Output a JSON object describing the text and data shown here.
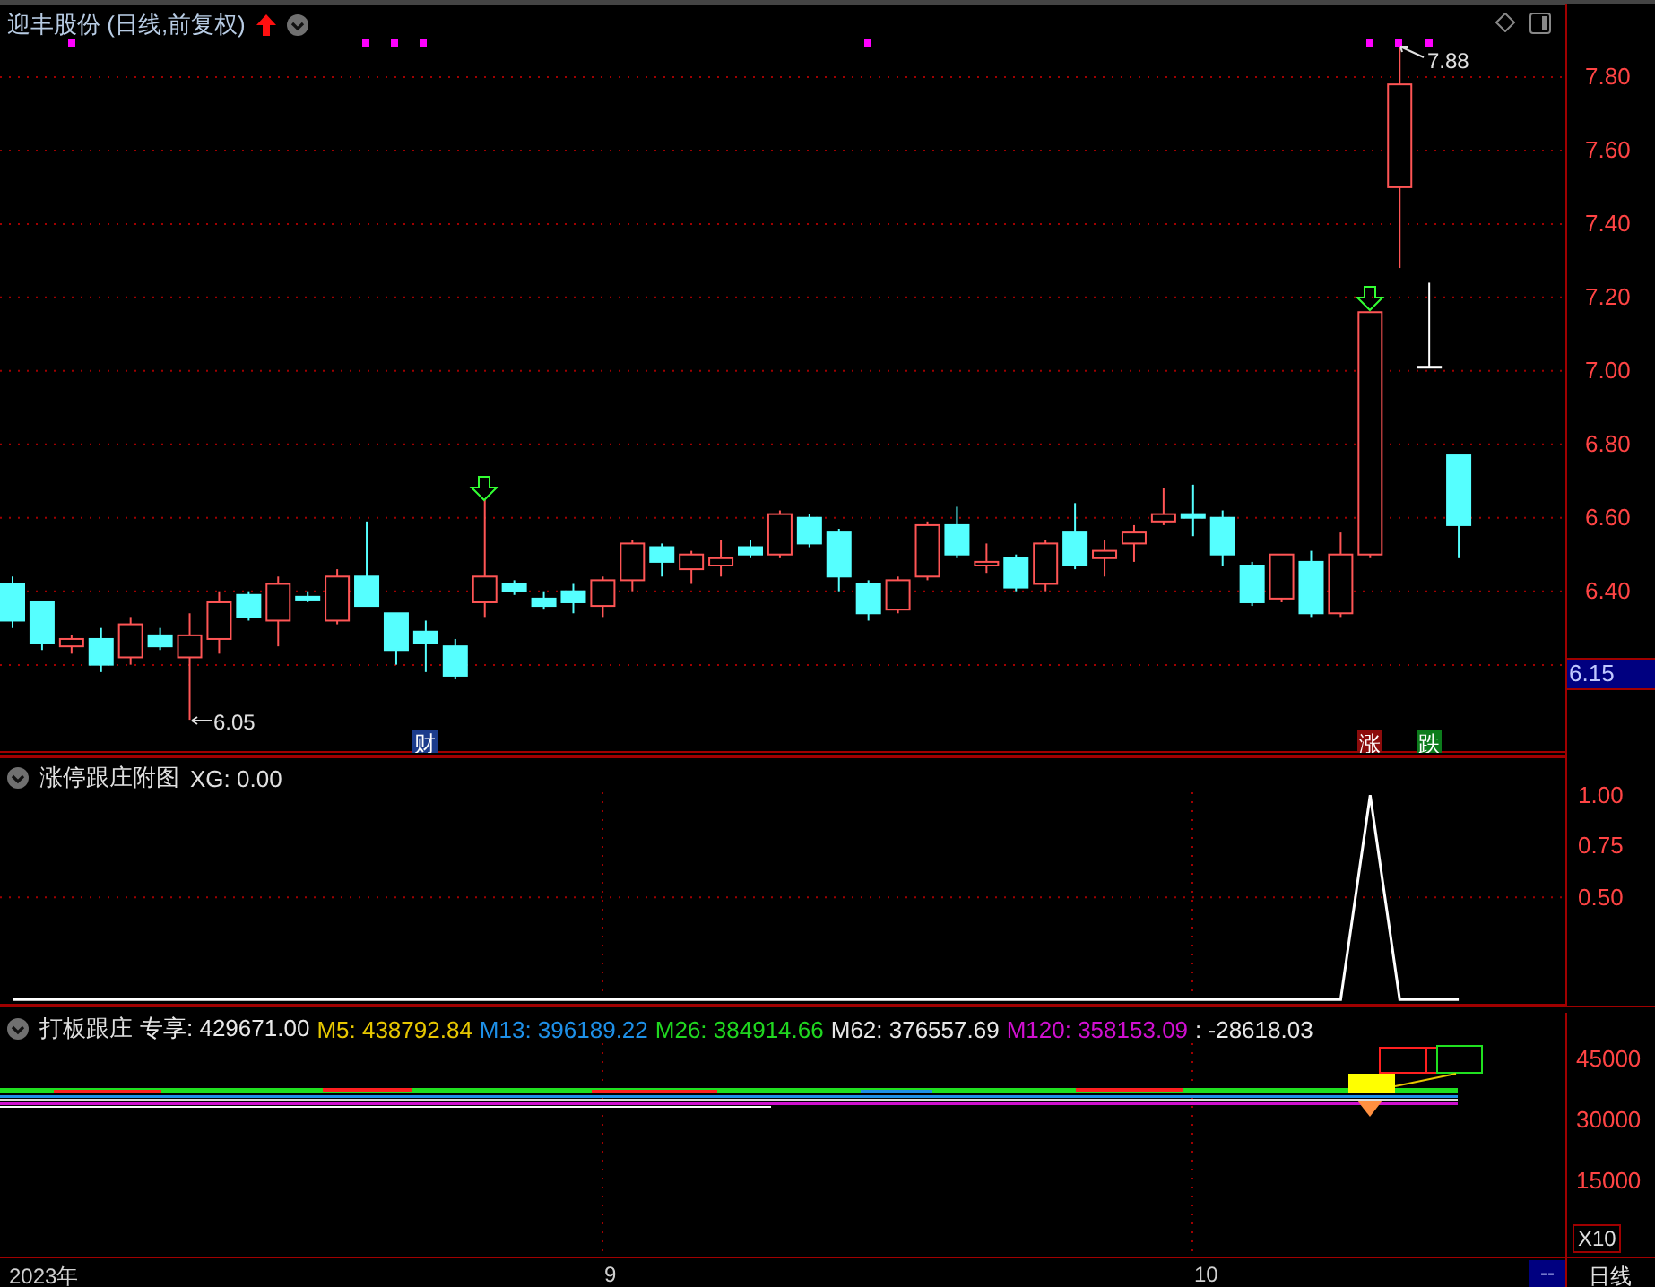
{
  "price_panel": {
    "title": "迎丰股份 (日线,前复权)",
    "current_price": "6.15",
    "low_label": "6.05",
    "high_label": "7.88",
    "markers": [
      {
        "label": "财",
        "color": "#1c3c8c"
      },
      {
        "label": "涨",
        "color": "#8c0c0c"
      },
      {
        "label": "跌",
        "color": "#0c7c1c"
      }
    ],
    "chart_data": {
      "type": "candlestick",
      "ylim": [
        5.96,
        8.0
      ],
      "grid": true,
      "yticks": [
        {
          "value": 7.8,
          "label": "7.80"
        },
        {
          "value": 7.6,
          "label": "7.60"
        },
        {
          "value": 7.4,
          "label": "7.40"
        },
        {
          "value": 7.2,
          "label": "7.20"
        },
        {
          "value": 7.0,
          "label": "7.00"
        },
        {
          "value": 6.8,
          "label": "6.80"
        },
        {
          "value": 6.6,
          "label": "6.60"
        },
        {
          "value": 6.4,
          "label": "6.40"
        }
      ],
      "ohlc": [
        [
          6.42,
          6.44,
          6.3,
          6.32
        ],
        [
          6.37,
          6.37,
          6.24,
          6.26
        ],
        [
          6.25,
          6.28,
          6.23,
          6.27
        ],
        [
          6.27,
          6.3,
          6.18,
          6.2
        ],
        [
          6.22,
          6.33,
          6.2,
          6.31
        ],
        [
          6.28,
          6.3,
          6.24,
          6.25
        ],
        [
          6.22,
          6.34,
          6.05,
          6.28
        ],
        [
          6.27,
          6.4,
          6.23,
          6.37
        ],
        [
          6.39,
          6.4,
          6.32,
          6.33
        ],
        [
          6.32,
          6.44,
          6.25,
          6.42
        ],
        [
          6.385,
          6.4,
          6.37,
          6.375
        ],
        [
          6.32,
          6.46,
          6.31,
          6.44
        ],
        [
          6.44,
          6.59,
          6.36,
          6.36
        ],
        [
          6.34,
          6.34,
          6.2,
          6.24
        ],
        [
          6.29,
          6.32,
          6.18,
          6.26
        ],
        [
          6.25,
          6.27,
          6.16,
          6.17
        ],
        [
          6.37,
          6.65,
          6.33,
          6.44
        ],
        [
          6.42,
          6.43,
          6.39,
          6.4
        ],
        [
          6.38,
          6.4,
          6.35,
          6.36
        ],
        [
          6.4,
          6.42,
          6.34,
          6.37
        ],
        [
          6.36,
          6.44,
          6.33,
          6.43
        ],
        [
          6.43,
          6.54,
          6.4,
          6.53
        ],
        [
          6.52,
          6.53,
          6.44,
          6.48
        ],
        [
          6.46,
          6.51,
          6.42,
          6.5
        ],
        [
          6.47,
          6.54,
          6.44,
          6.49
        ],
        [
          6.52,
          6.54,
          6.49,
          6.5
        ],
        [
          6.5,
          6.62,
          6.49,
          6.61
        ],
        [
          6.6,
          6.61,
          6.52,
          6.53
        ],
        [
          6.56,
          6.57,
          6.4,
          6.44
        ],
        [
          6.42,
          6.43,
          6.32,
          6.34
        ],
        [
          6.35,
          6.44,
          6.34,
          6.43
        ],
        [
          6.44,
          6.59,
          6.43,
          6.58
        ],
        [
          6.58,
          6.63,
          6.49,
          6.5
        ],
        [
          6.47,
          6.53,
          6.45,
          6.48
        ],
        [
          6.49,
          6.5,
          6.4,
          6.41
        ],
        [
          6.42,
          6.54,
          6.4,
          6.53
        ],
        [
          6.56,
          6.64,
          6.46,
          6.47
        ],
        [
          6.49,
          6.54,
          6.44,
          6.51
        ],
        [
          6.53,
          6.58,
          6.48,
          6.56
        ],
        [
          6.59,
          6.68,
          6.58,
          6.61
        ],
        [
          6.61,
          6.69,
          6.55,
          6.6
        ],
        [
          6.6,
          6.62,
          6.47,
          6.5
        ],
        [
          6.47,
          6.48,
          6.36,
          6.37
        ],
        [
          6.38,
          6.5,
          6.37,
          6.5
        ],
        [
          6.48,
          6.51,
          6.33,
          6.34
        ],
        [
          6.34,
          6.56,
          6.33,
          6.5
        ],
        [
          6.5,
          7.16,
          6.49,
          7.16
        ],
        [
          7.5,
          7.88,
          7.28,
          7.78
        ],
        [
          7.01,
          7.24,
          7.01,
          7.01
        ],
        [
          6.77,
          6.77,
          6.49,
          6.58
        ]
      ]
    }
  },
  "sub_panel": {
    "title": "涨停跟庄附图",
    "reading": "XG: 0.00",
    "chart_data": {
      "type": "line",
      "ylim": [
        -0.03,
        1.19
      ],
      "grid": true,
      "yticks": [
        {
          "value": 0.5,
          "label": "0.50"
        },
        {
          "value": 0.75,
          "label": "0.75"
        },
        {
          "value": 1,
          "label": "1.00"
        }
      ],
      "series": [
        {
          "color": "#ffffff",
          "values": [
            0,
            0,
            0,
            0,
            0,
            0,
            0,
            0,
            0,
            0,
            0,
            0,
            0,
            0,
            0,
            0,
            0,
            0,
            0,
            0,
            0,
            0,
            0,
            0,
            0,
            0,
            0,
            0,
            0,
            0,
            0,
            0,
            0,
            0,
            0,
            0,
            0,
            0,
            0,
            0,
            0,
            0,
            0,
            0,
            0,
            0,
            1,
            0,
            0,
            0
          ]
        }
      ]
    }
  },
  "volume_panel": {
    "title": "打板跟庄",
    "readings": [
      {
        "text": "专享: 429671.00",
        "color": "#e8e8e8"
      },
      {
        "text": "M5: 438792.84",
        "color": "#e8c800"
      },
      {
        "text": "M13: 396189.22",
        "color": "#1e90e8"
      },
      {
        "text": "M26: 384914.66",
        "color": "#20d820"
      },
      {
        "text": "M62: 376557.69",
        "color": "#e8e8e8"
      },
      {
        "text": "M120: 358153.09",
        "color": "#d010d0"
      },
      {
        "text": ": -28618.03",
        "color": "#e8e8e8"
      }
    ],
    "axis_ticks": [
      "45000",
      "30000",
      "15000"
    ],
    "scale": "X10"
  },
  "time_axis": {
    "labels": [
      "2023年",
      "9",
      "10"
    ],
    "range": "--",
    "period": "日线"
  }
}
